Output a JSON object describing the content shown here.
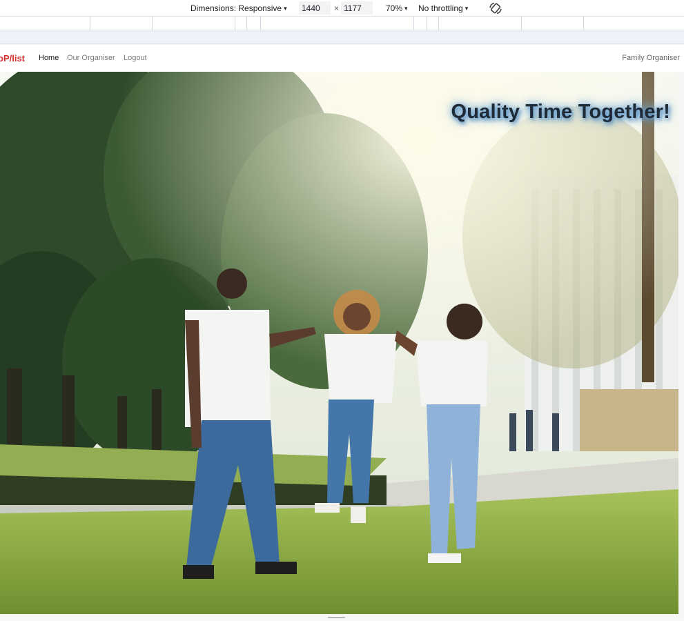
{
  "devtools": {
    "dimensions_label": "Dimensions: Responsive",
    "width": "1440",
    "times": "×",
    "height": "1177",
    "zoom": "70%",
    "throttling": "No throttling",
    "caret": "▾",
    "rotate_icon": "rotate-icon"
  },
  "site": {
    "brand": "oP/list",
    "nav": [
      {
        "label": "Home",
        "active": true
      },
      {
        "label": "Our Organiser",
        "active": false
      },
      {
        "label": "Logout",
        "active": false
      }
    ],
    "nav_right": "Family Organiser"
  },
  "hero": {
    "title": "Quality Time Together!",
    "image_description": "hero-family-photo"
  }
}
